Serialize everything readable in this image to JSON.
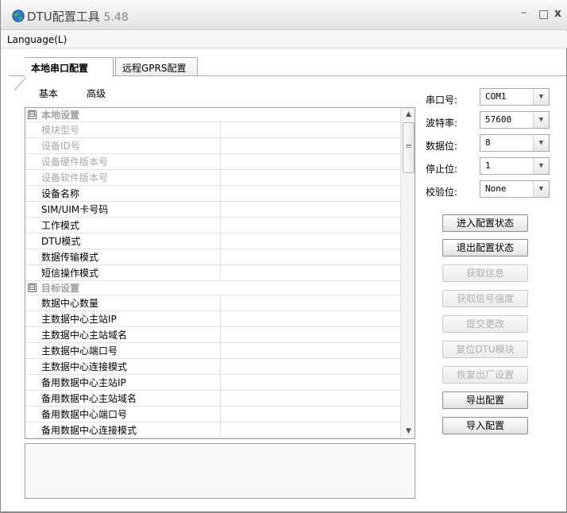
{
  "window": {
    "title": "DTU配置工具",
    "version": "5.48",
    "min_glyph": "–",
    "max_glyph": "□",
    "close_glyph": "x"
  },
  "menu": {
    "language": "Language(L)"
  },
  "tabs": [
    {
      "label": "本地串口配置",
      "active": true
    },
    {
      "label": "远程GPRS配置",
      "active": false
    }
  ],
  "subtabs": {
    "basic": "基本",
    "advanced": "高级"
  },
  "grid": {
    "rows": [
      {
        "type": "category",
        "label": "本地设置",
        "toggle": "⊟"
      },
      {
        "type": "item",
        "label": "模块型号",
        "disabled": true
      },
      {
        "type": "item",
        "label": "设备ID号",
        "disabled": true
      },
      {
        "type": "item",
        "label": "设备硬件版本号",
        "disabled": true
      },
      {
        "type": "item",
        "label": "设备软件版本号",
        "disabled": true
      },
      {
        "type": "item",
        "label": "设备名称",
        "disabled": false
      },
      {
        "type": "item",
        "label": "SIM/UIM卡号码",
        "disabled": false
      },
      {
        "type": "item",
        "label": "工作模式",
        "disabled": false
      },
      {
        "type": "item",
        "label": "DTU模式",
        "disabled": false
      },
      {
        "type": "item",
        "label": "数据传输模式",
        "disabled": false
      },
      {
        "type": "item",
        "label": "短信操作模式",
        "disabled": false
      },
      {
        "type": "category",
        "label": "目标设置",
        "toggle": "⊟"
      },
      {
        "type": "item",
        "label": "数据中心数量",
        "disabled": false
      },
      {
        "type": "item",
        "label": "主数据中心主站IP",
        "disabled": false
      },
      {
        "type": "item",
        "label": "主数据中心主站域名",
        "disabled": false
      },
      {
        "type": "item",
        "label": "主数据中心端口号",
        "disabled": false
      },
      {
        "type": "item",
        "label": "主数据中心连接模式",
        "disabled": false
      },
      {
        "type": "item",
        "label": "备用数据中心主站IP",
        "disabled": false
      },
      {
        "type": "item",
        "label": "备用数据中心主站域名",
        "disabled": false
      },
      {
        "type": "item",
        "label": "备用数据中心端口号",
        "disabled": false
      },
      {
        "type": "item",
        "label": "备用数据中心连接模式",
        "disabled": false
      }
    ]
  },
  "serial": {
    "port": {
      "label": "串口号:",
      "value": "COM1"
    },
    "baud": {
      "label": "波特率:",
      "value": "57600"
    },
    "databits": {
      "label": "数据位:",
      "value": "8"
    },
    "stopbits": {
      "label": "停止位:",
      "value": "1"
    },
    "parity": {
      "label": "校验位:",
      "value": "None"
    }
  },
  "buttons": [
    {
      "label": "进入配置状态",
      "enabled": true
    },
    {
      "label": "退出配置状态",
      "enabled": true
    },
    {
      "label": "获取信息",
      "enabled": false
    },
    {
      "label": "获取信号强度",
      "enabled": false
    },
    {
      "label": "提交更改",
      "enabled": false
    },
    {
      "label": "复位DTU模块",
      "enabled": false
    },
    {
      "label": "恢复出厂设置",
      "enabled": false
    },
    {
      "label": "导出配置",
      "enabled": true
    },
    {
      "label": "导入配置",
      "enabled": true
    }
  ],
  "colors": {
    "accent": "#2a78c8",
    "disabled_text": "#a8a8a8",
    "border": "#9e9e9e"
  }
}
